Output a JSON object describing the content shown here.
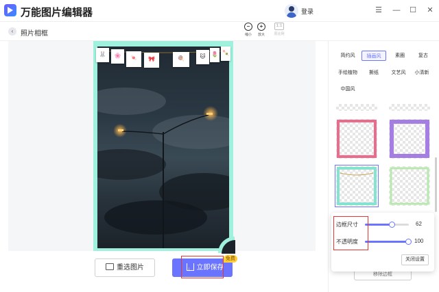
{
  "app": {
    "title": "万能图片编辑器",
    "login_label": "登录"
  },
  "window_controls": {
    "menu": "☰",
    "minimize": "—",
    "maximize": "☐",
    "close": "✕"
  },
  "subbar": {
    "back": "‹",
    "title": "照片相框",
    "tools": [
      {
        "icon": "−",
        "label": "缩小"
      },
      {
        "icon": "+",
        "label": "放大"
      },
      {
        "icon": "1:1",
        "label": "原比例"
      }
    ]
  },
  "photo": {
    "cards": [
      "🐰",
      "🌸",
      "🍬",
      "🎀",
      "🍭",
      "🐱",
      "🌷",
      "🍡"
    ]
  },
  "actions": {
    "reselect_label": "重选图片",
    "save_label": "立即保存",
    "free_badge": "免费"
  },
  "panel": {
    "categories": [
      {
        "label": "简约风",
        "active": false
      },
      {
        "label": "插画风",
        "active": true
      },
      {
        "label": "素圈",
        "active": false
      },
      {
        "label": "复古",
        "active": false
      },
      {
        "label": "手绘植物",
        "active": false
      },
      {
        "label": "撕纸",
        "active": false
      },
      {
        "label": "文艺风",
        "active": false
      },
      {
        "label": "小清新",
        "active": false
      },
      {
        "label": "中国风",
        "active": false
      }
    ],
    "frame_colors": [
      "#ec6b8b",
      "#a47ee0",
      "#86e3cf",
      "#b8e8b0"
    ],
    "hidden_button_label": "移除边框"
  },
  "settings": {
    "border_size": {
      "label": "边框尺寸",
      "value": 62,
      "max": 100
    },
    "opacity": {
      "label": "不透明度",
      "value": 100,
      "max": 100
    },
    "close_label": "关闭设置"
  },
  "colors": {
    "accent": "#6a74ff",
    "frame": "#9ff0dc",
    "highlight": "#e33333",
    "badge": "#ffcf3a"
  }
}
